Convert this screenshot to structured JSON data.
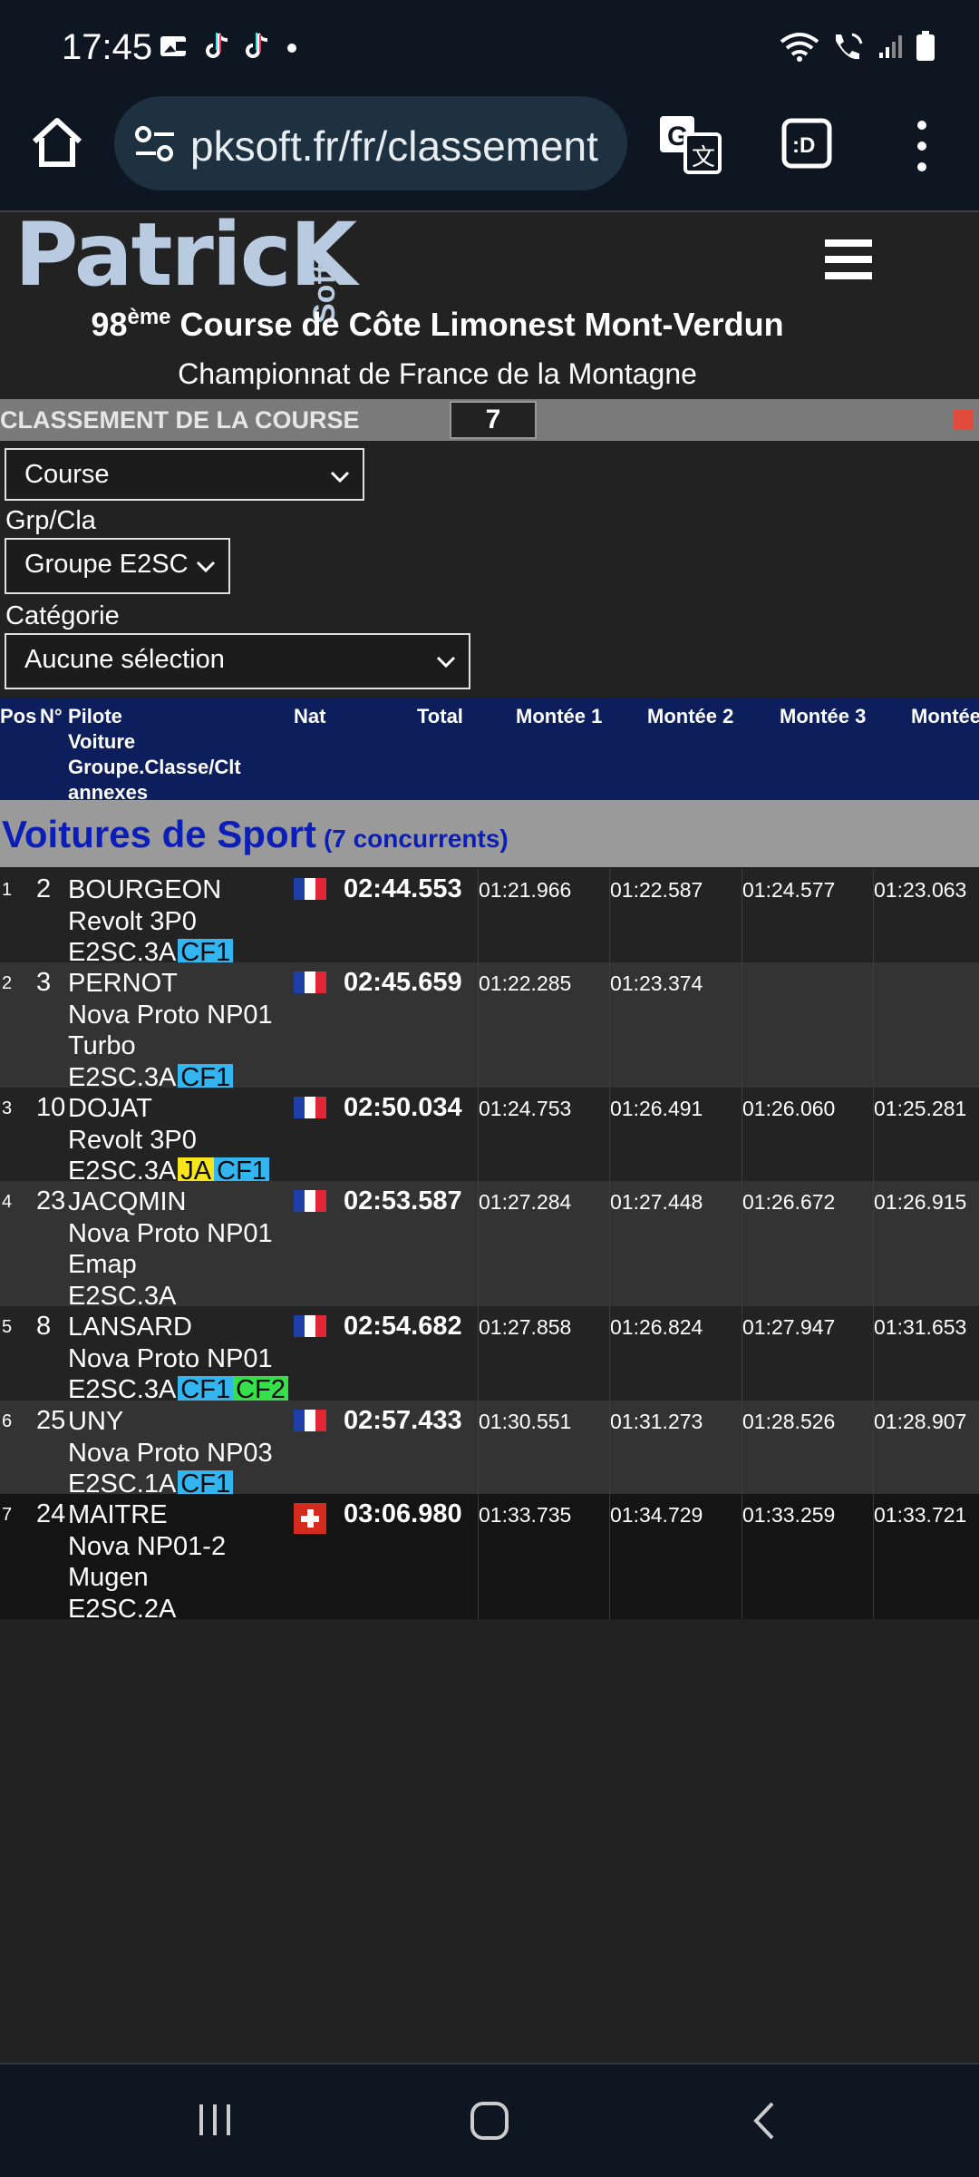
{
  "status_bar": {
    "time": "17:45",
    "left_icons": [
      "photo-card-icon",
      "tiktok-icon",
      "tiktok-icon",
      "dot-icon"
    ],
    "right_icons": [
      "wifi-icon",
      "wifi-call-icon",
      "signal-icon",
      "battery-icon"
    ]
  },
  "browser": {
    "url": "pksoft.fr/fr/classement"
  },
  "header": {
    "logo": "PatricK",
    "logo_sub": "Soft",
    "event_number": "98",
    "event_sup": "ème",
    "event_name": " Course de Côte Limonest Mont-Verdun",
    "championship": "Championnat de France de la Montagne"
  },
  "section": {
    "label": "CLASSEMENT DE LA COURSE",
    "count": "7",
    "indicator_color": "#e24a3b"
  },
  "filters": {
    "race_select": "Course",
    "group_label": "Grp/Cla",
    "group_select": "Groupe E2SC",
    "category_label": "Catégorie",
    "category_select": "Aucune sélection"
  },
  "table_header": {
    "pos": "Pos",
    "num": "N°",
    "pilot_lines": [
      "Pilote",
      "Voiture",
      "Groupe.Classe/Clt",
      "annexes"
    ],
    "nat": "Nat",
    "total": "Total",
    "m1": "Montée 1",
    "m2": "Montée 2",
    "m3": "Montée 3",
    "m4": "Montée"
  },
  "group": {
    "title": "Voitures de Sport",
    "count": "(7 concurrents)"
  },
  "rows": [
    {
      "pos": "1",
      "num": "2",
      "pilot": "BOURGEON",
      "car": [
        "Revolt 3P0"
      ],
      "class": "E2SC.3A",
      "badges": [
        "CF1"
      ],
      "nat": "FR",
      "total": "02:44.553",
      "m1": "01:21.966",
      "m2": "01:22.587",
      "m3": "01:24.577",
      "m4": "01:23.063"
    },
    {
      "pos": "2",
      "num": "3",
      "pilot": "PERNOT",
      "car": [
        "Nova Proto NP01",
        "Turbo"
      ],
      "class": "E2SC.3A",
      "badges": [
        "CF1"
      ],
      "nat": "FR",
      "total": "02:45.659",
      "m1": "01:22.285",
      "m2": "01:23.374",
      "m3": "",
      "m4": ""
    },
    {
      "pos": "3",
      "num": "10",
      "pilot": "DOJAT",
      "car": [
        "Revolt 3P0"
      ],
      "class": "E2SC.3A",
      "badges": [
        "JA",
        "CF1"
      ],
      "nat": "FR",
      "total": "02:50.034",
      "m1": "01:24.753",
      "m2": "01:26.491",
      "m3": "01:26.060",
      "m4": "01:25.281"
    },
    {
      "pos": "4",
      "num": "23",
      "pilot": "JACQMIN",
      "car": [
        "Nova Proto NP01",
        "Emap"
      ],
      "class": "E2SC.3A",
      "badges": [],
      "nat": "FR",
      "total": "02:53.587",
      "m1": "01:27.284",
      "m2": "01:27.448",
      "m3": "01:26.672",
      "m4": "01:26.915"
    },
    {
      "pos": "5",
      "num": "8",
      "pilot": "LANSARD",
      "car": [
        "Nova Proto NP01"
      ],
      "class": "E2SC.3A",
      "badges": [
        "CF1",
        "CF2"
      ],
      "nat": "FR",
      "total": "02:54.682",
      "m1": "01:27.858",
      "m2": "01:26.824",
      "m3": "01:27.947",
      "m4": "01:31.653"
    },
    {
      "pos": "6",
      "num": "25",
      "pilot": "UNY",
      "car": [
        "Nova Proto NP03"
      ],
      "class": "E2SC.1A",
      "badges": [
        "CF1"
      ],
      "nat": "FR",
      "total": "02:57.433",
      "m1": "01:30.551",
      "m2": "01:31.273",
      "m3": "01:28.526",
      "m4": "01:28.907"
    },
    {
      "pos": "7",
      "num": "24",
      "pilot": "MAITRE",
      "car": [
        "Nova NP01-2",
        "Mugen"
      ],
      "class": "E2SC.2A",
      "badges": [],
      "nat": "CH",
      "total": "03:06.980",
      "m1": "01:33.735",
      "m2": "01:34.729",
      "m3": "01:33.259",
      "m4": "01:33.721"
    }
  ],
  "colors": {
    "header_blue": "#0c1e5c",
    "group_title": "#0b1fb8",
    "row_dark": "#232323",
    "row_light": "#333333",
    "row_last": "#141414",
    "badge_cf1": "#33b5f0",
    "badge_cf2": "#35e04b",
    "badge_ja": "#f5e51a"
  },
  "nav_bar": {
    "icons": [
      "recents-icon",
      "home-icon",
      "back-icon"
    ]
  }
}
